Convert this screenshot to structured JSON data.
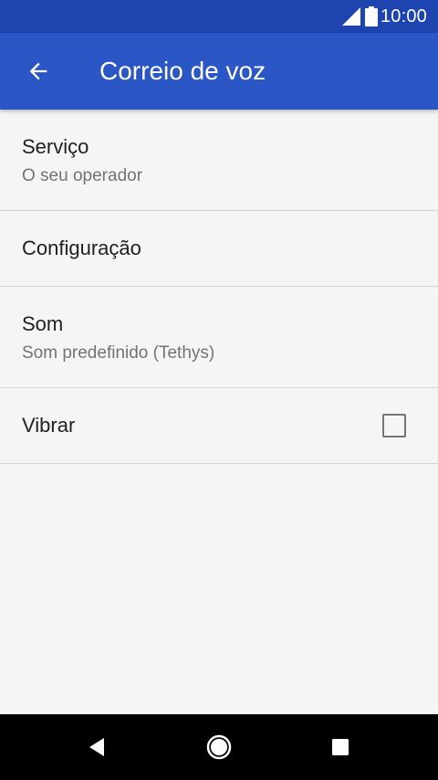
{
  "status_bar": {
    "time": "10:00",
    "signal_icon": "cell-signal-icon",
    "battery_icon": "battery-icon"
  },
  "app_bar": {
    "title": "Correio de voz",
    "back_icon": "arrow-back-icon",
    "colors": {
      "app_bar": "#2a56c6",
      "status_bar": "#1e44b0"
    }
  },
  "preferences": {
    "service": {
      "title": "Serviço",
      "summary": "O seu operador"
    },
    "configuration": {
      "title": "Configuração"
    },
    "sound": {
      "title": "Som",
      "summary": "Som predefinido (Tethys)"
    },
    "vibrate": {
      "title": "Vibrar",
      "checked": false
    }
  },
  "nav_bar": {
    "back_icon": "nav-back-triangle-icon",
    "home_icon": "nav-home-circle-icon",
    "recents_icon": "nav-recents-square-icon"
  }
}
